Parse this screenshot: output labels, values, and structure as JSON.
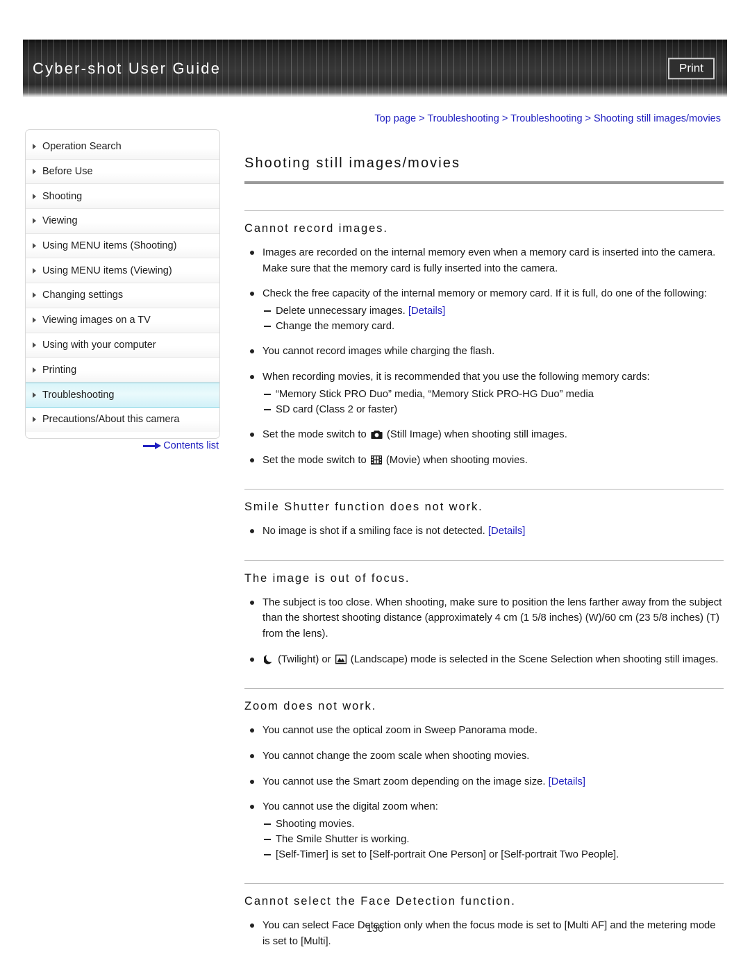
{
  "header": {
    "title": "Cyber-shot User Guide",
    "print_label": "Print"
  },
  "breadcrumb": {
    "items": [
      "Top page",
      "Troubleshooting",
      "Troubleshooting",
      "Shooting still images/movies"
    ],
    "separator": ">",
    "full_text": "Top page > Troubleshooting > Troubleshooting > Shooting still images/movies",
    "link_color": "#2020c0"
  },
  "sidebar": {
    "items": [
      {
        "label": "Operation Search",
        "active": false
      },
      {
        "label": "Before Use",
        "active": false
      },
      {
        "label": "Shooting",
        "active": false
      },
      {
        "label": "Viewing",
        "active": false
      },
      {
        "label": "Using MENU items (Shooting)",
        "active": false
      },
      {
        "label": "Using MENU items (Viewing)",
        "active": false
      },
      {
        "label": "Changing settings",
        "active": false
      },
      {
        "label": "Viewing images on a TV",
        "active": false
      },
      {
        "label": "Using with your computer",
        "active": false
      },
      {
        "label": "Printing",
        "active": false
      },
      {
        "label": "Troubleshooting",
        "active": true
      },
      {
        "label": "Precautions/About this camera",
        "active": false
      }
    ],
    "contents_link": "Contents list",
    "active_highlight_color": "#d8f4f9",
    "active_border_color": "#7fd4e4"
  },
  "main": {
    "page_title": "Shooting still images/movies",
    "sections": [
      {
        "title": "Cannot record images.",
        "bullets": [
          {
            "text": "Images are recorded on the internal memory even when a memory card is inserted into the camera. Make sure that the memory card is fully inserted into the camera."
          },
          {
            "text": "Check the free capacity of the internal memory or memory card. If it is full, do one of the following:",
            "sub": [
              {
                "text": "Delete unnecessary images.",
                "link": "[Details]"
              },
              {
                "text": "Change the memory card."
              }
            ]
          },
          {
            "text": "You cannot record images while charging the flash."
          },
          {
            "text": "When recording movies, it is recommended that you use the following memory cards:",
            "sub": [
              {
                "text": "“Memory Stick PRO Duo” media, “Memory Stick PRO-HG Duo” media"
              },
              {
                "text": "SD card (Class 2 or faster)"
              }
            ]
          },
          {
            "pre": "Set the mode switch to ",
            "icon": "still-image-camera-icon",
            "post": " (Still Image) when shooting still images."
          },
          {
            "pre": "Set the mode switch to ",
            "icon": "movie-filmstrip-icon",
            "post": " (Movie) when shooting movies."
          }
        ]
      },
      {
        "title": "Smile Shutter function does not work.",
        "bullets": [
          {
            "text": "No image is shot if a smiling face is not detected.",
            "link": "[Details]"
          }
        ]
      },
      {
        "title": "The image is out of focus.",
        "bullets": [
          {
            "text": "The subject is too close. When shooting, make sure to position the lens farther away from the subject than the shortest shooting distance (approximately 4 cm (1 5/8 inches) (W)/60 cm (23 5/8 inches) (T) from the lens)."
          },
          {
            "pre": "",
            "icon": "twilight-moon-icon",
            "mid": " (Twilight) or ",
            "icon2": "landscape-mountain-icon",
            "post": " (Landscape) mode is selected in the Scene Selection when shooting still images."
          }
        ]
      },
      {
        "title": "Zoom does not work.",
        "bullets": [
          {
            "text": "You cannot use the optical zoom in Sweep Panorama mode."
          },
          {
            "text": "You cannot change the zoom scale when shooting movies."
          },
          {
            "text": "You cannot use the Smart zoom depending on the image size.",
            "link": "[Details]"
          },
          {
            "text": "You cannot use the digital zoom when:",
            "sub": [
              {
                "text": "Shooting movies."
              },
              {
                "text": "The Smile Shutter is working."
              },
              {
                "text": "[Self-Timer] is set to [Self-portrait One Person] or [Self-portrait Two People]."
              }
            ]
          }
        ]
      },
      {
        "title": "Cannot select the Face Detection function.",
        "bullets": [
          {
            "text": "You can select Face Detection only when the focus mode is set to [Multi AF] and the metering mode is set to [Multi]."
          }
        ]
      }
    ]
  },
  "footer": {
    "page_number": "136"
  }
}
